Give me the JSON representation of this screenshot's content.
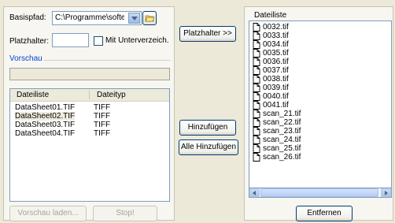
{
  "left": {
    "basispfad_label": "Basispfad:",
    "basispfad_value": "C:\\Programme\\softelec\\",
    "platzhalter_label": "Platzhalter:",
    "platzhalter_value": "",
    "subdirs_label": "Mit Unterverzeich.",
    "preview_group": "Vorschau",
    "preview_value": "",
    "list": {
      "columns": [
        "Dateiliste",
        "Dateityp"
      ],
      "rows": [
        {
          "name": "DataSheet01.TIF",
          "type": "TIFF"
        },
        {
          "name": "DataSheet02.TIF",
          "type": "TIFF"
        },
        {
          "name": "DataSheet03.TIF",
          "type": "TIFF"
        },
        {
          "name": "DataSheet04.TIF",
          "type": "TIFF"
        }
      ]
    },
    "buttons": {
      "preview_load": "Vorschau laden...",
      "stop": "Stop!"
    }
  },
  "middle": {
    "placeholder_btn": "Platzhalter >>",
    "add_btn": "Hinzufügen",
    "add_all_btn": "Alle Hinzufügen"
  },
  "right": {
    "header": "Dateiliste",
    "files": [
      "0032.tif",
      "0033.tif",
      "0034.tif",
      "0035.tif",
      "0036.tif",
      "0037.tif",
      "0038.tif",
      "0039.tif",
      "0040.tif",
      "0041.tif",
      "scan_21.tif",
      "scan_22.tif",
      "scan_23.tif",
      "scan_24.tif",
      "scan_25.tif",
      "scan_26.tif"
    ],
    "remove_btn": "Entfernen"
  }
}
